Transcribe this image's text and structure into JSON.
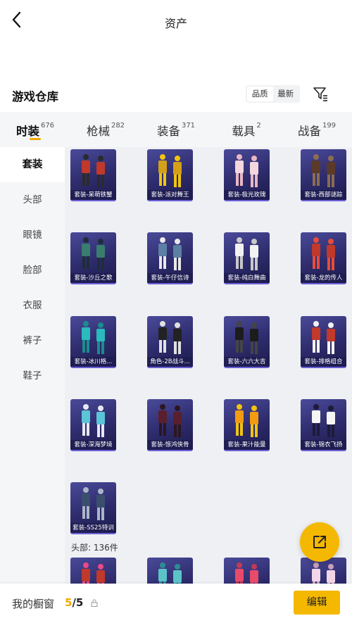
{
  "header": {
    "title": "资产"
  },
  "warehouse": {
    "title": "游戏仓库"
  },
  "sort": {
    "options": [
      "品质",
      "最新"
    ]
  },
  "category_tabs": [
    {
      "label": "时装",
      "count": "676"
    },
    {
      "label": "枪械",
      "count": "282"
    },
    {
      "label": "装备",
      "count": "371"
    },
    {
      "label": "载具",
      "count": "2"
    },
    {
      "label": "战备",
      "count": "199"
    }
  ],
  "sidebar": {
    "items": [
      "套装",
      "头部",
      "眼镜",
      "脸部",
      "衣服",
      "裤子",
      "鞋子"
    ]
  },
  "items": [
    {
      "name": "套装-呆萌铁蟹",
      "palette": [
        "#c0392b",
        "#2b2b2b"
      ]
    },
    {
      "name": "套装-派对舞王",
      "palette": [
        "#d4a017",
        "#f1c40f"
      ]
    },
    {
      "name": "套装-极光玫瑰",
      "palette": [
        "#f4d6de",
        "#e8b7c4"
      ]
    },
    {
      "name": "套装-西部谜踪",
      "palette": [
        "#5b3a29",
        "#8a6d52"
      ]
    },
    {
      "name": "套装-沙丘之歌",
      "palette": [
        "#3a7d6e",
        "#1f2d3a"
      ]
    },
    {
      "name": "套装-午仔信诗",
      "palette": [
        "#5d7fa3",
        "#e8e8e8"
      ]
    },
    {
      "name": "套装-纯白舞曲",
      "palette": [
        "#f2f2f2",
        "#c8c8c8"
      ]
    },
    {
      "name": "套装-龙的传人",
      "palette": [
        "#c0392b",
        "#e74c3c"
      ]
    },
    {
      "name": "套装-冰川格...",
      "palette": [
        "#2bbbbd",
        "#1a8c8e"
      ]
    },
    {
      "name": "角色-2B战斗...",
      "palette": [
        "#222222",
        "#e0e0e0"
      ]
    },
    {
      "name": "套装-六六大吉",
      "palette": [
        "#1c1c1c",
        "#444444"
      ]
    },
    {
      "name": "套装-排格组合",
      "palette": [
        "#c0392b",
        "#f2f2f2"
      ]
    },
    {
      "name": "套装-深海梦境",
      "palette": [
        "#5bc4d6",
        "#e8e8f4"
      ]
    },
    {
      "name": "套装-惊鸿侠骨",
      "palette": [
        "#5a1f2c",
        "#2c1620"
      ]
    },
    {
      "name": "套装-果汁能量",
      "palette": [
        "#f39c12",
        "#f1c40f"
      ]
    },
    {
      "name": "套装-锦衣飞扬",
      "palette": [
        "#f5f5f5",
        "#1c1c3a"
      ]
    },
    {
      "name": "套装-SS25特训",
      "palette": [
        "#3a4f6e",
        "#aab6c8"
      ]
    }
  ],
  "group": {
    "head_label": "头部: 136件"
  },
  "partial_items": [
    {
      "palette": [
        "#c0392b",
        "#e84a8a"
      ]
    },
    {
      "palette": [
        "#5bc4c8",
        "#2c8e92"
      ]
    },
    {
      "palette": [
        "#e84a6a",
        "#c0395b"
      ]
    },
    {
      "palette": [
        "#f2d6e8",
        "#c8a0b8"
      ]
    }
  ],
  "bottom": {
    "showcase_label": "我的橱窗",
    "used": "5",
    "total": "/5",
    "edit_label": "编辑"
  },
  "colors": {
    "accent": "#f5b800",
    "card_bg": "#2d2b6b",
    "grid_bg": "#eef0f3"
  },
  "icons": {
    "back": "chevron-left-icon",
    "filter": "filter-icon",
    "share": "share-icon",
    "lock": "lock-icon"
  }
}
